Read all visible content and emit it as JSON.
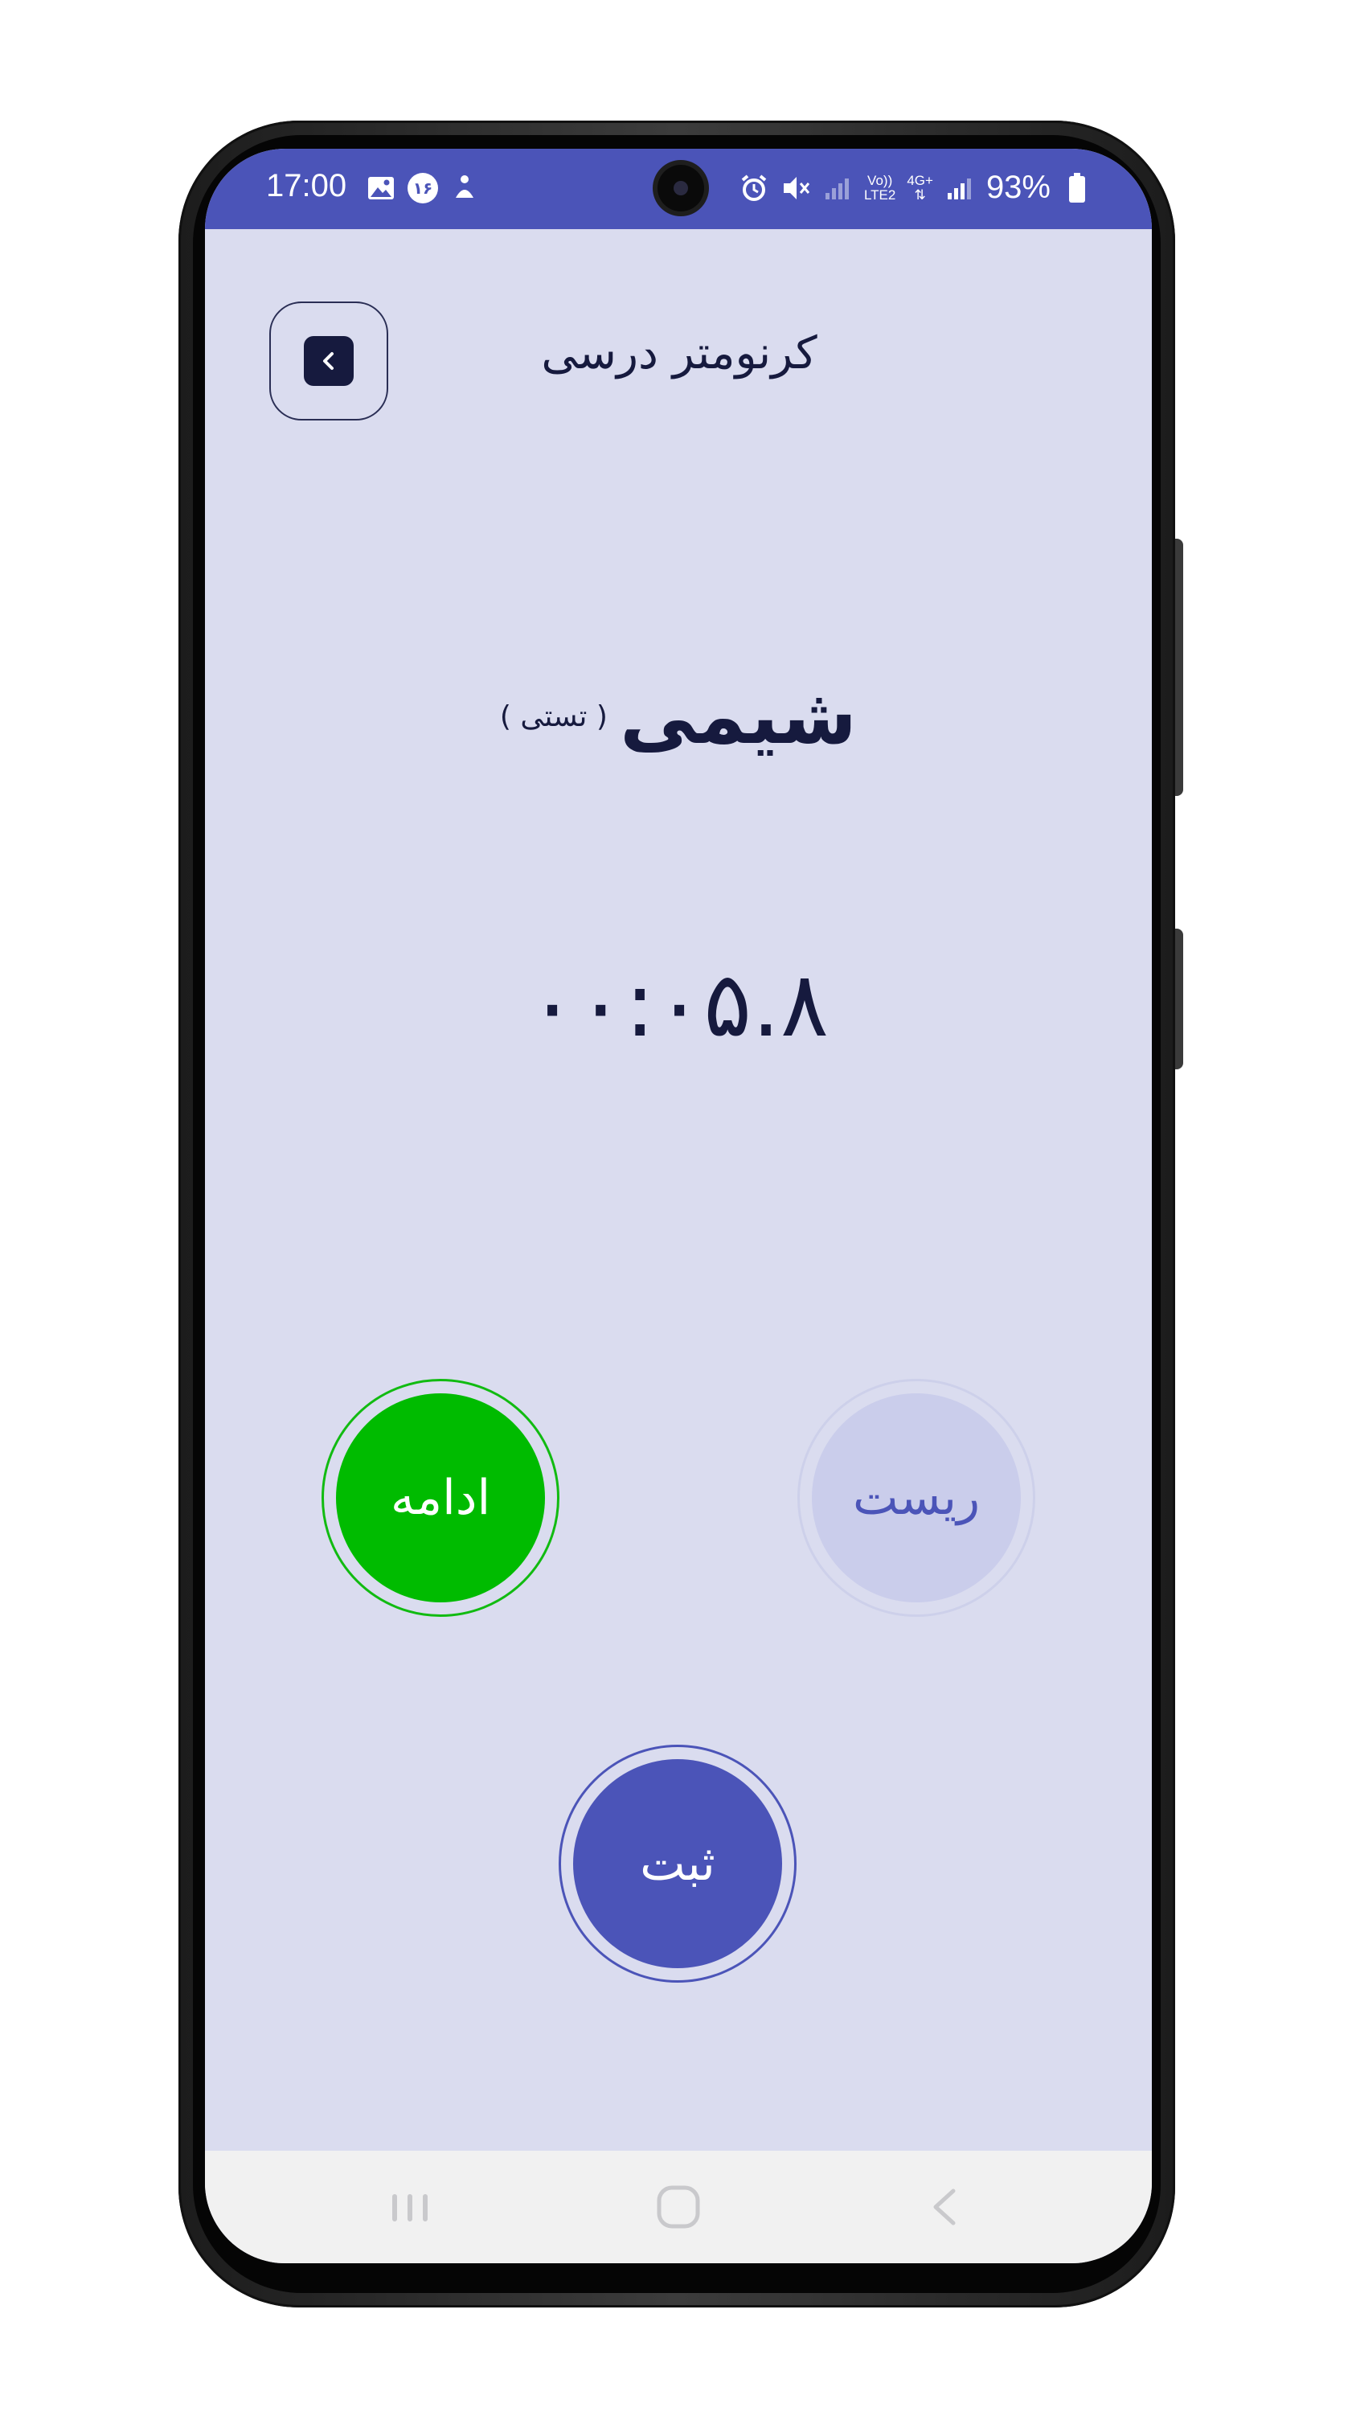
{
  "status_bar": {
    "time": "17:00",
    "notification_badge": "۱۶",
    "network_top": "Vo))",
    "network_bottom": "LTE2",
    "network_type": "4G+",
    "battery": "93%"
  },
  "header": {
    "title": "کرنومتر درسی"
  },
  "subject": {
    "name": "شیمی",
    "type": "( تستی )"
  },
  "timer": {
    "display": "۰۰:۰۵.۸"
  },
  "buttons": {
    "continue_label": "ادامه",
    "reset_label": "ریست",
    "save_label": "ثبت"
  },
  "colors": {
    "accent": "#4b54b8",
    "background": "#dadcef",
    "continue": "#00bb00",
    "text": "#161a3e"
  },
  "icons": {
    "back": "chevron-left-icon",
    "nav_recents": "recents-icon",
    "nav_home": "home-icon",
    "nav_back": "back-icon"
  }
}
